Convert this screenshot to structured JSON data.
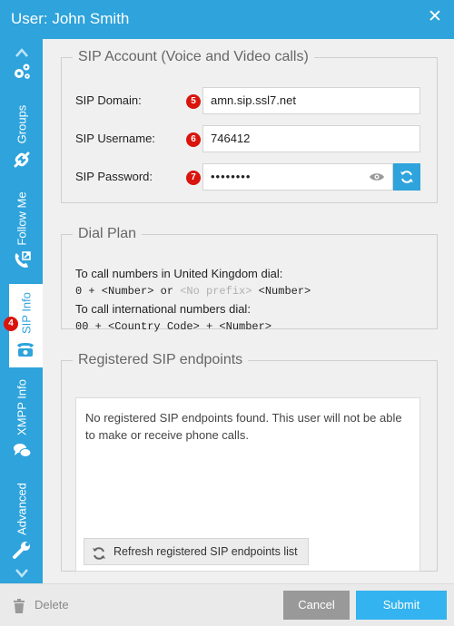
{
  "window": {
    "title": "User: John Smith"
  },
  "tabs": [
    {
      "label": "Groups"
    },
    {
      "label": "Follow Me"
    },
    {
      "label": "SIP Info",
      "badge": "4"
    },
    {
      "label": "XMPP Info"
    },
    {
      "label": "Advanced"
    }
  ],
  "sip_account": {
    "legend": "SIP Account (Voice and Video calls)",
    "domain": {
      "label": "SIP Domain:",
      "badge": "5",
      "value": "amn.sip.ssl7.net"
    },
    "username": {
      "label": "SIP Username:",
      "badge": "6",
      "value": "746412"
    },
    "password": {
      "label": "SIP Password:",
      "badge": "7",
      "value": "••••••••"
    }
  },
  "dial_plan": {
    "legend": "Dial Plan",
    "uk_line": "To call numbers in United Kingdom dial:",
    "uk_rule_a": "0 + <Number> or ",
    "uk_rule_muted": "<No prefix>",
    "uk_rule_b": " <Number>",
    "intl_line": "To call international numbers dial:",
    "intl_rule": "00 + <Country Code> + <Number>"
  },
  "endpoints": {
    "legend": "Registered SIP endpoints",
    "message": "No registered SIP endpoints found. This user will not be able to make or receive phone calls.",
    "refresh_label": "Refresh registered SIP endpoints list"
  },
  "footer": {
    "delete_label": "Delete",
    "cancel_label": "Cancel",
    "submit_label": "Submit"
  },
  "colors": {
    "accent": "#2ea3dc",
    "badge": "#d9140d",
    "submit": "#33b3ef",
    "cancel": "#999999"
  }
}
